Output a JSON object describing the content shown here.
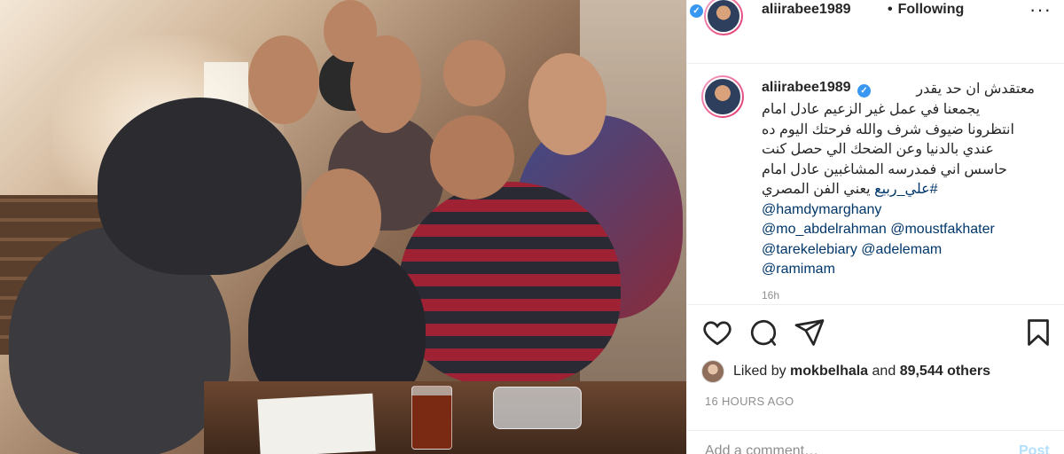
{
  "post": {
    "image_alt": "",
    "author": "aliirabee1989",
    "follow_status": "Following",
    "more_icon": "more-icon"
  },
  "caption": {
    "username": "aliirabee1989",
    "first_line": "معتقدش ان حد يقدر",
    "lines": [
      "يجمعنا في عمل غير الزعيم عادل امام",
      "انتظرونا ضيوف شرف والله فرحتك اليوم ده",
      "عندي بالدنيا وعن الضحك الي حصل كنت",
      "حاسس اني فمدرسه المشاغبين عادل امام",
      "يعني الفن المصري"
    ],
    "hashtag": "#علي_ربيع",
    "mentions": [
      "@hamdymarghany",
      "@mo_abdelrahman",
      "@moustfakhater",
      "@tarekelebiary",
      "@adelemam",
      "@ramimam"
    ],
    "time": "16h"
  },
  "actions": {
    "like_icon": "heart-icon",
    "comment_icon": "comment-icon",
    "share_icon": "share-icon",
    "save_icon": "bookmark-icon"
  },
  "likes": {
    "prefix": "Liked by",
    "user": "mokbelhala",
    "suffix": "and",
    "count": "89,544 others"
  },
  "posted": "16 HOURS AGO",
  "comment_box": {
    "placeholder": "Add a comment…",
    "post_label": "Post"
  },
  "colors": {
    "verified": "#3897f0",
    "link": "#00376b",
    "muted": "#8e8e8e",
    "post_disabled": "#b2dffc"
  }
}
